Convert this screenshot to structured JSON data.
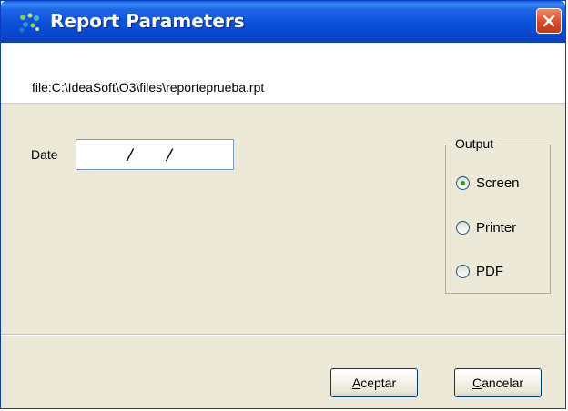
{
  "window": {
    "title": "Report Parameters",
    "file_path": "file:C:\\IdeaSoft\\O3\\files\\reporteprueba.rpt"
  },
  "form": {
    "date_label": "Date",
    "date_value": "  /   /"
  },
  "output": {
    "legend": "Output",
    "options": [
      {
        "label": "Screen",
        "selected": true
      },
      {
        "label": "Printer",
        "selected": false
      },
      {
        "label": "PDF",
        "selected": false
      }
    ]
  },
  "buttons": {
    "accept": {
      "hotkey": "A",
      "rest": "ceptar"
    },
    "cancel": {
      "hotkey": "C",
      "rest": "ancelar"
    }
  },
  "colors": {
    "titlebar": "#0a50d8",
    "dialog_bg": "#ece9d8",
    "close_button": "#d9461e",
    "radio_selected": "#3d9a2a"
  }
}
